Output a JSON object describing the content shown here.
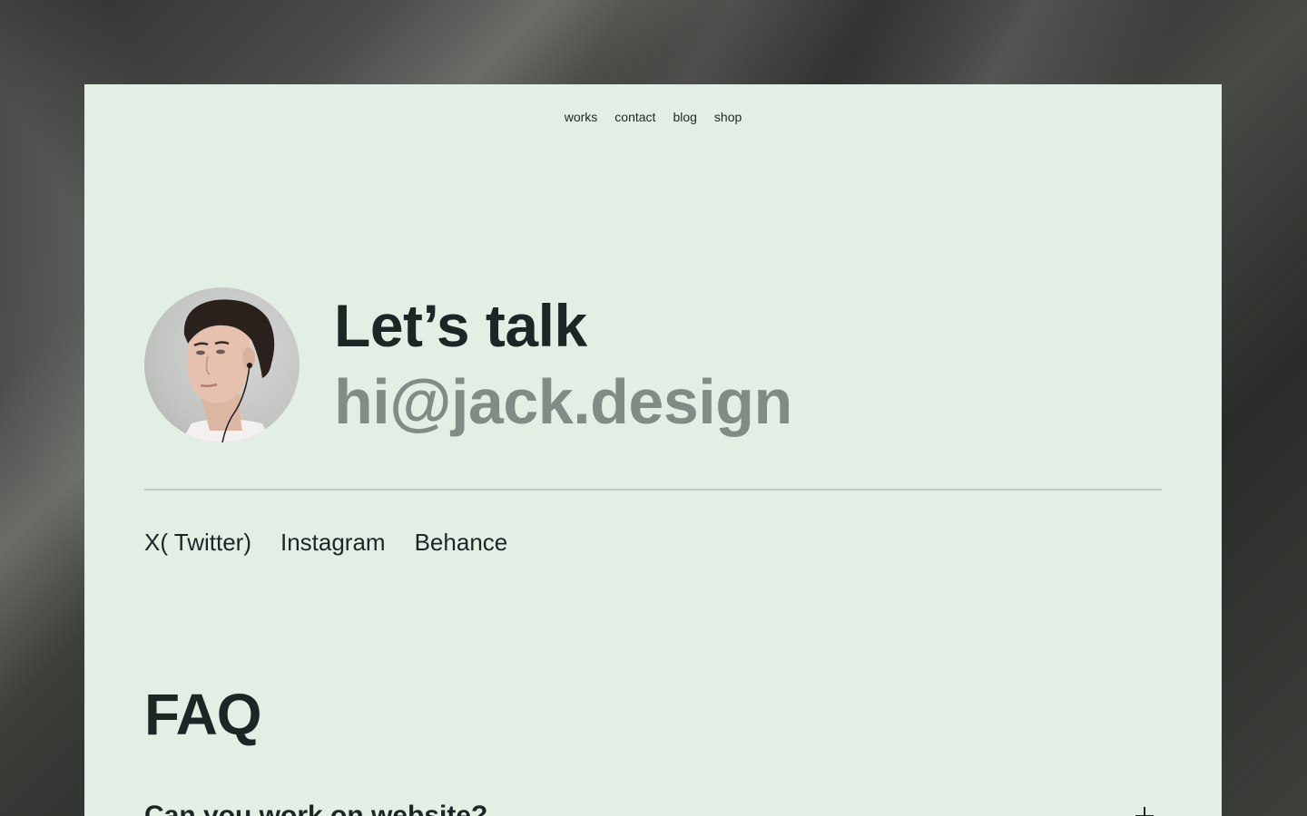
{
  "nav": {
    "items": [
      {
        "label": "works"
      },
      {
        "label": "contact"
      },
      {
        "label": "blog"
      },
      {
        "label": "shop"
      }
    ]
  },
  "hero": {
    "title": "Let’s talk",
    "email": "hi@jack.design",
    "avatar_alt": "portrait photo"
  },
  "socials": {
    "items": [
      {
        "label": "X( Twitter)"
      },
      {
        "label": "Instagram"
      },
      {
        "label": "Behance"
      }
    ]
  },
  "faq": {
    "title": "FAQ",
    "first_question": "Can you work on website?"
  },
  "colors": {
    "card_bg": "#e3eee4",
    "text_dark": "#1a2725",
    "email_grey": "#818c86",
    "divider": "#bcccc0"
  }
}
